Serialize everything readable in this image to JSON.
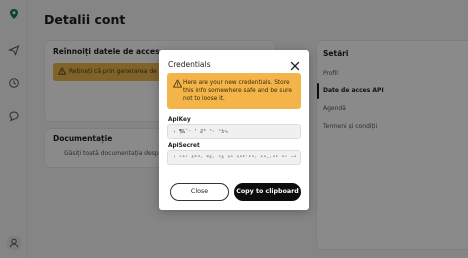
{
  "page": {
    "title": "Detalii cont"
  },
  "background": {
    "regen_card": {
      "title": "Reînnoiți datele de acces",
      "warning": "Rețineți că prin generarea de noi"
    },
    "doc_card": {
      "title": "Documentație",
      "text": "Găsiți toată documentația despre API"
    },
    "settings": {
      "title": "Setări",
      "items": [
        {
          "label": "Profil",
          "active": false
        },
        {
          "label": "Date de acces API",
          "active": true
        },
        {
          "label": "Agendă",
          "active": false
        },
        {
          "label": "Termeni și condiții",
          "active": false
        }
      ]
    }
  },
  "sidebar": {
    "icons": [
      "pin-logo-icon",
      "send-icon",
      "history-icon",
      "chat-icon",
      "user-icon"
    ]
  },
  "modal": {
    "title": "Credentials",
    "alert": "Here are your new credentials. Store this info somewhere safe and be sure not to loose it.",
    "api_key_label": "ApiKey",
    "api_key_value": "‹ ¶&˘⁻ ‛ Ƨ⁰ ⁿ· ⁿƾ∿",
    "api_secret_label": "ApiSecret",
    "api_secret_value": "⁽ ⁿᵃᶜ ᵟ⁰ᵈ· ᵂᵝ· ᵎᵝ ᵍᵃ ᵑᵃᵇ˙ᵏᵃ· ᶝᵃ‐·ᵃᵏ ᵃᶜ ᵕᵃ",
    "close_label": "Close",
    "copy_label": "Copy to clipboard"
  },
  "colors": {
    "accent": "#1a7f4b",
    "alert_bg": "#f3b54a",
    "primary_btn": "#0d0d0d"
  }
}
